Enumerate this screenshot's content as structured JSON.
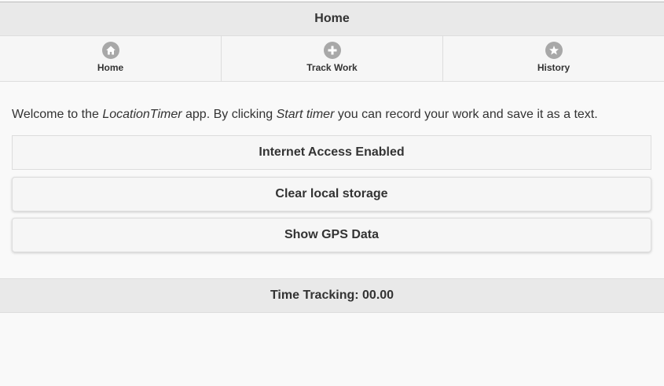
{
  "header": {
    "title": "Home"
  },
  "navbar": {
    "items": [
      {
        "label": "Home",
        "icon": "home-icon"
      },
      {
        "label": "Track Work",
        "icon": "plus-icon"
      },
      {
        "label": "History",
        "icon": "star-icon"
      }
    ]
  },
  "intro": {
    "part1": "Welcome to the ",
    "app_name": "LocationTimer",
    "part2": " app. By clicking ",
    "action": "Start timer",
    "part3": " you can record your work and save it as a text."
  },
  "buttons": {
    "internet": "Internet Access Enabled",
    "clear": "Clear local storage",
    "gps": "Show GPS Data"
  },
  "footer": {
    "text": "Time Tracking: 00.00"
  },
  "colors": {
    "icon_bg": "#a8a8a8",
    "bar_bg": "#e9e9e9",
    "button_bg": "#f6f6f6",
    "text": "#333333"
  }
}
